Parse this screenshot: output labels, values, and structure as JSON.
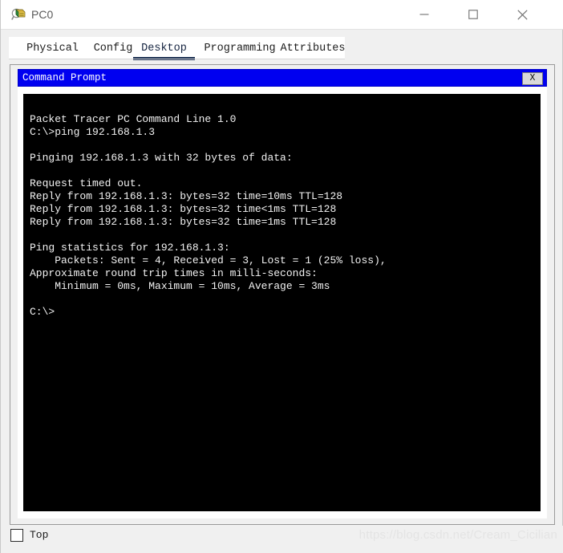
{
  "window": {
    "title": "PC0",
    "icon": "packet-tracer-pc-icon",
    "controls": {
      "minimize_label": "—",
      "maximize_label": "□",
      "close_label": "×"
    }
  },
  "tabs": [
    {
      "label": "Physical",
      "selected": false
    },
    {
      "label": "Config",
      "selected": false
    },
    {
      "label": "Desktop",
      "selected": true
    },
    {
      "label": "Programming",
      "selected": false
    },
    {
      "label": "Attributes",
      "selected": false
    }
  ],
  "command_prompt": {
    "title": "Command Prompt",
    "close_label": "X",
    "titlebar_color": "#0000f0",
    "terminal_bg": "#000000",
    "terminal_fg": "#f2f2f2",
    "output": "Packet Tracer PC Command Line 1.0\nC:\\>ping 192.168.1.3\n\nPinging 192.168.1.3 with 32 bytes of data:\n\nRequest timed out.\nReply from 192.168.1.3: bytes=32 time=10ms TTL=128\nReply from 192.168.1.3: bytes=32 time<1ms TTL=128\nReply from 192.168.1.3: bytes=32 time=1ms TTL=128\n\nPing statistics for 192.168.1.3:\n    Packets: Sent = 4, Received = 3, Lost = 1 (25% loss),\nApproximate round trip times in milli-seconds:\n    Minimum = 0ms, Maximum = 10ms, Average = 3ms\n\nC:\\>"
  },
  "footer": {
    "top_label": "Top",
    "top_checked": false,
    "watermark": "https://blog.csdn.net/Cream_Cicilian"
  }
}
